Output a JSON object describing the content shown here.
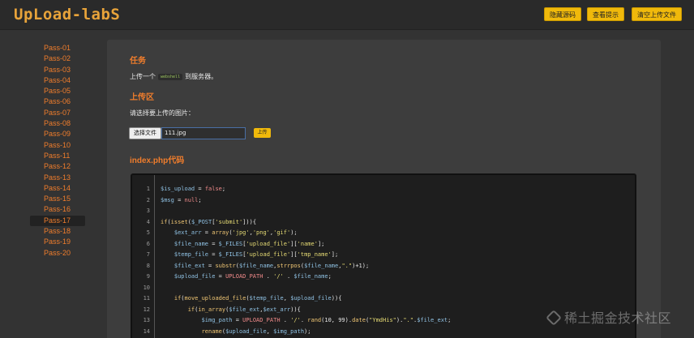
{
  "header": {
    "logo": "UpLoad-labS",
    "buttons": [
      "隐藏源码",
      "查看提示",
      "清空上传文件"
    ]
  },
  "sidebar": {
    "items": [
      "Pass-01",
      "Pass-02",
      "Pass-03",
      "Pass-04",
      "Pass-05",
      "Pass-06",
      "Pass-07",
      "Pass-08",
      "Pass-09",
      "Pass-10",
      "Pass-11",
      "Pass-12",
      "Pass-13",
      "Pass-14",
      "Pass-15",
      "Pass-16",
      "Pass-17",
      "Pass-18",
      "Pass-19",
      "Pass-20"
    ],
    "active": "Pass-17"
  },
  "main": {
    "task_heading": "任务",
    "task_prefix": "上传一个",
    "task_chip": "webshell",
    "task_suffix": "到服务器。",
    "upload_heading": "上传区",
    "upload_prompt": "请选择要上传的图片：",
    "choose_file_label": "选择文件",
    "file_name": "111.jpg",
    "upload_button": "上传",
    "code_heading": "index.php代码"
  },
  "code": {
    "line_numbers": [
      "1",
      "2",
      "3",
      "4",
      "5",
      "6",
      "7",
      "8",
      "9",
      "10",
      "11",
      "12",
      "13",
      "14"
    ],
    "lines": [
      "$is_upload = false;",
      "$msg = null;",
      "",
      "if(isset($_POST['submit'])){",
      "    $ext_arr = array('jpg','png','gif');",
      "    $file_name = $_FILES['upload_file']['name'];",
      "    $temp_file = $_FILES['upload_file']['tmp_name'];",
      "    $file_ext = substr($file_name,strrpos($file_name,\".\")+1);",
      "    $upload_file = UPLOAD_PATH . '/' . $file_name;",
      "",
      "    if(move_uploaded_file($temp_file, $upload_file)){",
      "        if(in_array($file_ext,$ext_arr)){",
      "            $img_path = UPLOAD_PATH . '/'. rand(10, 99).date(\"YmdHis\").\".\".$file_ext;",
      "            rename($upload_file, $img_path);"
    ]
  },
  "watermark": "稀土掘金技术社区",
  "colors": {
    "accent": "#f07d2c",
    "button": "#f0b90b",
    "code_bg": "#1e1e1e",
    "panel_bg": "#3d3d3d"
  }
}
